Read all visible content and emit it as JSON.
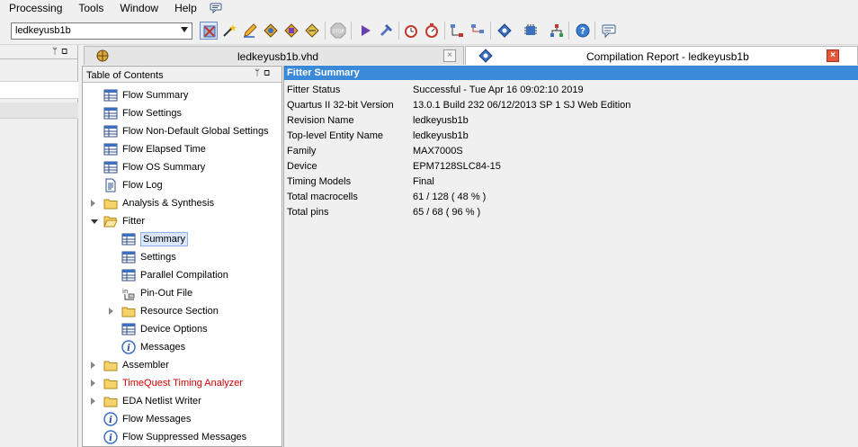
{
  "menu": [
    "Processing",
    "Tools",
    "Window",
    "Help"
  ],
  "toolbar": {
    "project_combo": "ledkeyusb1b",
    "buttons": [
      "compile-mode-icon",
      "wand-icon",
      "pencil-icon",
      "analyze-icon",
      "assignment-icon",
      "design-icon",
      "stop-icon",
      "start-compile-icon",
      "start-analysis-icon",
      "timing-icon",
      "timer-icon",
      "netlist-viewer-icon",
      "netlist-icon",
      "programmer-icon",
      "chip-planner-icon",
      "tree-icon",
      "help-icon",
      "chat-icon"
    ]
  },
  "tabs": [
    {
      "title": "ledkeyusb1b.vhd",
      "close": "×"
    },
    {
      "title": "Compilation Report - ledkeyusb1b",
      "close": "×"
    }
  ],
  "pin_glyphs": "ᛘ ⧉",
  "toc": {
    "title": "Table of Contents",
    "items": [
      {
        "label": "Flow Summary",
        "icon": "table-icon",
        "level": 1,
        "expander": "none"
      },
      {
        "label": "Flow Settings",
        "icon": "table-icon",
        "level": 1,
        "expander": "none"
      },
      {
        "label": "Flow Non-Default Global Settings",
        "icon": "table-icon",
        "level": 1,
        "expander": "none"
      },
      {
        "label": "Flow Elapsed Time",
        "icon": "table-icon",
        "level": 1,
        "expander": "none"
      },
      {
        "label": "Flow OS Summary",
        "icon": "table-icon",
        "level": 1,
        "expander": "none"
      },
      {
        "label": "Flow Log",
        "icon": "document-icon",
        "level": 1,
        "expander": "none"
      },
      {
        "label": "Analysis & Synthesis",
        "icon": "folder-icon",
        "level": 1,
        "expander": "closed"
      },
      {
        "label": "Fitter",
        "icon": "folder-open-icon",
        "level": 1,
        "expander": "open"
      },
      {
        "label": "Summary",
        "icon": "table-icon",
        "level": 2,
        "expander": "none",
        "selected": true
      },
      {
        "label": "Settings",
        "icon": "table-icon",
        "level": 2,
        "expander": "none"
      },
      {
        "label": "Parallel Compilation",
        "icon": "table-icon",
        "level": 2,
        "expander": "none"
      },
      {
        "label": "Pin-Out File",
        "icon": "pinout-icon",
        "level": 2,
        "expander": "none"
      },
      {
        "label": "Resource Section",
        "icon": "folder-icon",
        "level": 2,
        "expander": "closed"
      },
      {
        "label": "Device Options",
        "icon": "table-icon",
        "level": 2,
        "expander": "none"
      },
      {
        "label": "Messages",
        "icon": "info-icon",
        "level": 2,
        "expander": "none"
      },
      {
        "label": "Assembler",
        "icon": "folder-icon",
        "level": 1,
        "expander": "closed"
      },
      {
        "label": "TimeQuest Timing Analyzer",
        "icon": "folder-icon",
        "level": 1,
        "expander": "closed",
        "color": "#d40000"
      },
      {
        "label": "EDA Netlist Writer",
        "icon": "folder-icon",
        "level": 1,
        "expander": "closed"
      },
      {
        "label": "Flow Messages",
        "icon": "info-icon",
        "level": 1,
        "expander": "none"
      },
      {
        "label": "Flow Suppressed Messages",
        "icon": "info-icon",
        "level": 1,
        "expander": "none"
      }
    ]
  },
  "report": {
    "title": "Fitter Summary",
    "rows": [
      [
        "Fitter Status",
        "Successful - Tue Apr 16 09:02:10 2019"
      ],
      [
        "Quartus II 32-bit Version",
        "13.0.1 Build 232 06/12/2013 SP 1 SJ Web Edition"
      ],
      [
        "Revision Name",
        "ledkeyusb1b"
      ],
      [
        "Top-level Entity Name",
        "ledkeyusb1b"
      ],
      [
        "Family",
        "MAX7000S"
      ],
      [
        "Device",
        "EPM7128SLC84-15"
      ],
      [
        "Timing Models",
        "Final"
      ],
      [
        "Total macrocells",
        "61 / 128 ( 48 % )"
      ],
      [
        "Total pins",
        "65 / 68 ( 96 % )"
      ]
    ]
  },
  "colors": {
    "accent": "#3b8ad9",
    "warning_red": "#d40000",
    "close_red": "#e05a3a"
  }
}
